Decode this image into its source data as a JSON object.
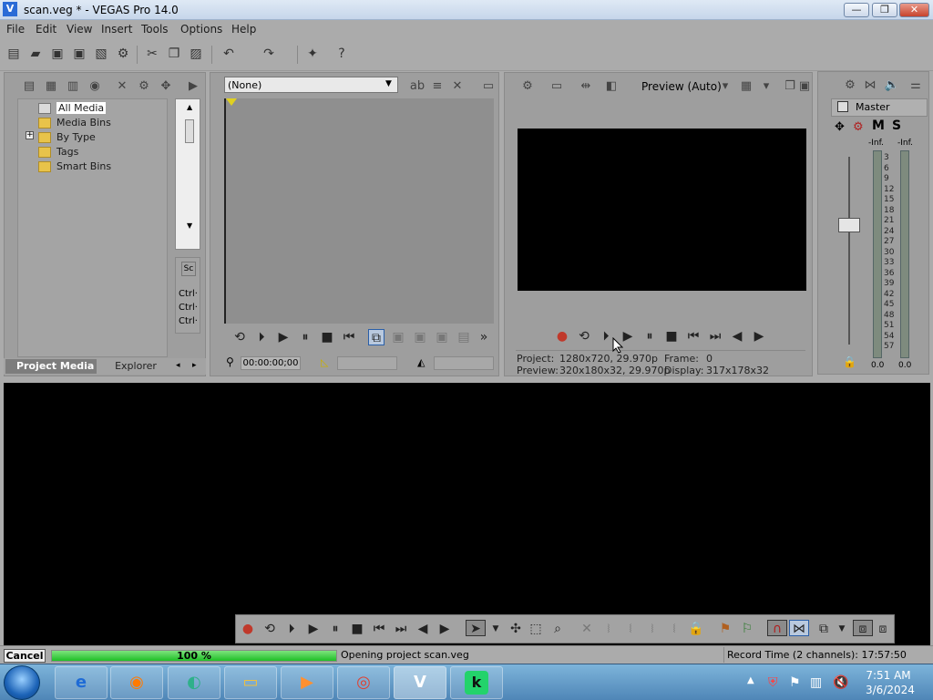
{
  "window": {
    "title": "scan.veg * - VEGAS Pro 14.0",
    "minimize": "—",
    "maximize": "❐",
    "close": "✕"
  },
  "menu": [
    "File",
    "Edit",
    "View",
    "Insert",
    "Tools",
    "Options",
    "Help"
  ],
  "toolbar": {
    "icons": [
      "new-icon",
      "open-icon",
      "save-icon",
      "save-as-icon",
      "render-icon",
      "properties-icon",
      "cut-icon",
      "copy-icon",
      "paste-icon",
      "undo-icon",
      "redo-icon",
      "burn-icon",
      "help-icon"
    ]
  },
  "project_media": {
    "tree": [
      "All Media",
      "Media Bins",
      "By Type",
      "Tags",
      "Smart Bins"
    ],
    "expander": "+",
    "tabs": {
      "active": "Project Media",
      "inactive": "Explorer"
    }
  },
  "trimmer": {
    "dropdown_value": "(None)",
    "ctrl_labels": [
      "Ctrl·",
      "Ctrl·",
      "Ctrl·"
    ],
    "timecode": "00:00:00;00"
  },
  "preview": {
    "mode": "Preview (Auto)",
    "project_label": "Project:",
    "project_value": "1280x720, 29.970p",
    "preview_label": "Preview:",
    "preview_value": "320x180x32, 29.970p",
    "frame_label": "Frame:",
    "frame_value": "0",
    "display_label": "Display:",
    "display_value": "317x178x32"
  },
  "master": {
    "title": "Master",
    "m_label": "M",
    "s_label": "S",
    "peak_left": "-Inf.",
    "peak_right": "-Inf.",
    "scale": [
      "3",
      "6",
      "9",
      "12",
      "15",
      "18",
      "21",
      "24",
      "27",
      "30",
      "33",
      "36",
      "39",
      "42",
      "45",
      "48",
      "51",
      "54",
      "57"
    ],
    "bottom_left": "0.0",
    "bottom_right": "0.0"
  },
  "status": {
    "cancel_label": "Cancel",
    "progress_text": "100 %",
    "progress_percent": 100,
    "message": "Opening project scan.veg",
    "record_time": "Record Time (2 channels): 17:57:50"
  },
  "taskbar": {
    "apps": [
      "internet-explorer-icon",
      "firefox-icon",
      "edge-icon",
      "file-explorer-icon",
      "media-player-icon",
      "chrome-icon",
      "vegas-icon",
      "k-app-icon"
    ],
    "k_label": "k",
    "time": "7:51 AM",
    "date": "3/6/2024"
  },
  "colors": {
    "progress": "#1fbf26",
    "background": "#ababab",
    "video": "#000000"
  }
}
